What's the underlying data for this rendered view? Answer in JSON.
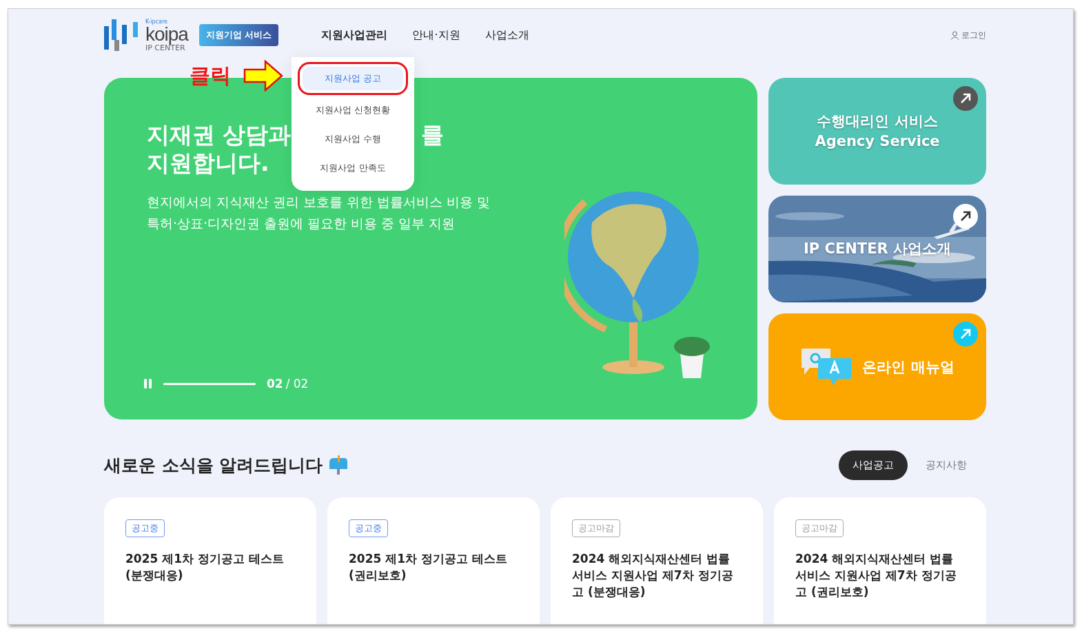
{
  "logo": {
    "tagline": "K-ipcare",
    "name": "koipa",
    "sub": "IP CENTER"
  },
  "service_badge": "지원기업 서비스",
  "nav": [
    {
      "label": "지원사업관리",
      "expanded": true
    },
    {
      "label": "안내·지원",
      "expanded": false
    },
    {
      "label": "사업소개",
      "expanded": false
    }
  ],
  "login": "로그인",
  "dropdown": [
    {
      "label": "지원사업 공고",
      "selected": true
    },
    {
      "label": "지원사업 신청현황",
      "selected": false
    },
    {
      "label": "지원사업 수행",
      "selected": false
    },
    {
      "label": "지원사업 만족도",
      "selected": false
    }
  ],
  "annotation": {
    "label": "클릭"
  },
  "hero": {
    "title_start": "지재권 상담과",
    "title_end": "를",
    "title_line2": "지원합니다.",
    "description": "현지에서의 지식재산 권리 보호를 위한 법률서비스 비용 및\n특허·상표·디자인권 출원에 필요한 비용 중 일부 지원",
    "current": "02",
    "total": "/ 02"
  },
  "side_cards": [
    {
      "kind": "text",
      "color": "#52c5b6",
      "title": "수행대리인 서비스",
      "subtitle": "Agency Service"
    },
    {
      "title": "IP CENTER 사업소개"
    },
    {
      "kind": "qa",
      "color": "#fca600",
      "title": "온라인 매뉴얼"
    }
  ],
  "news": {
    "heading": "새로운 소식을 알려드립니다",
    "tabs": [
      {
        "label": "사업공고",
        "selected": true
      },
      {
        "label": "공지사항",
        "selected": false
      }
    ],
    "cards": [
      {
        "status": "공고중",
        "open": true,
        "title": "2025 제1차 정기공고 테스트\n(분쟁대응)"
      },
      {
        "status": "공고중",
        "open": true,
        "title": "2025 제1차 정기공고 테스트\n(권리보호)"
      },
      {
        "status": "공고마감",
        "open": false,
        "title": "2024 해외지식재산센터 법률\n서비스 지원사업 제7차 정기공\n고 (분쟁대응)"
      },
      {
        "status": "공고마감",
        "open": false,
        "title": "2024 해외지식재산센터 법률\n서비스 지원사업 제7차 정기공\n고 (권리보호)"
      }
    ]
  }
}
